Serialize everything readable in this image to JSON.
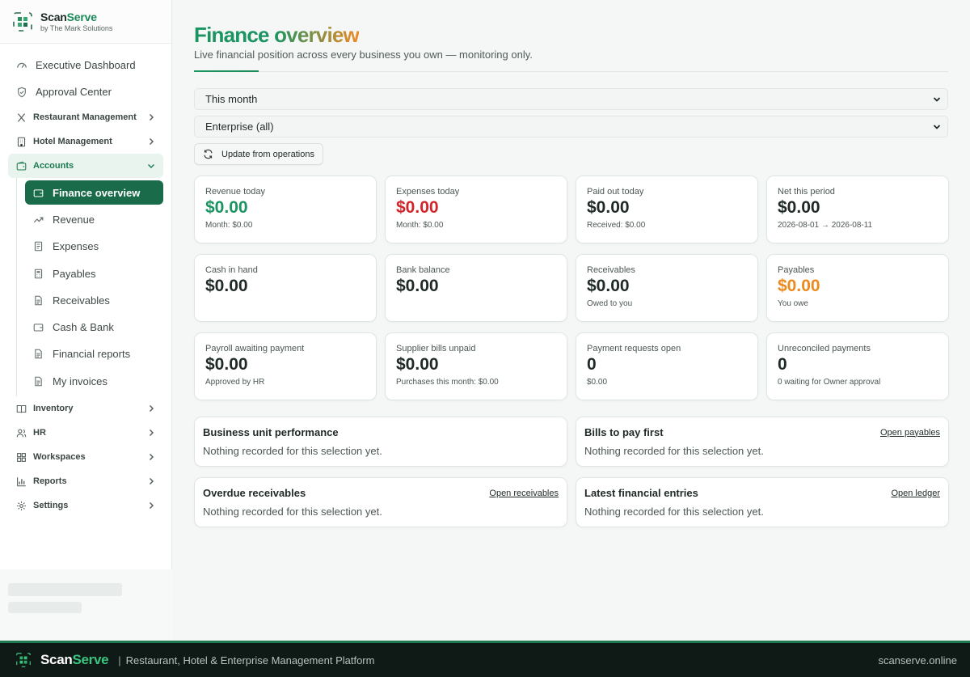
{
  "brand": {
    "name_a": "Scan",
    "name_b": "Serve",
    "sub": "by The Mark Solutions"
  },
  "sidebar": {
    "top_items": [
      {
        "label": "Executive Dashboard",
        "icon": "gauge-icon"
      },
      {
        "label": "Approval Center",
        "icon": "shield-check-icon"
      }
    ],
    "groups_before": [
      {
        "label": "Restaurant Management",
        "icon": "utensils-icon"
      },
      {
        "label": "Hotel Management",
        "icon": "building-icon"
      }
    ],
    "accounts": {
      "label": "Accounts",
      "icon": "wallet-icon",
      "items": [
        {
          "label": "Finance overview",
          "icon": "wallet-icon",
          "active": true
        },
        {
          "label": "Revenue",
          "icon": "trending-up-icon"
        },
        {
          "label": "Expenses",
          "icon": "receipt-icon"
        },
        {
          "label": "Payables",
          "icon": "calculator-icon"
        },
        {
          "label": "Receivables",
          "icon": "file-text-icon"
        },
        {
          "label": "Cash & Bank",
          "icon": "wallet-icon"
        },
        {
          "label": "Financial reports",
          "icon": "file-text-icon"
        },
        {
          "label": "My invoices",
          "icon": "file-text-icon"
        }
      ]
    },
    "groups_after": [
      {
        "label": "Inventory",
        "icon": "book-open-icon"
      },
      {
        "label": "HR",
        "icon": "users-icon"
      },
      {
        "label": "Workspaces",
        "icon": "grid-icon"
      },
      {
        "label": "Reports",
        "icon": "bar-chart-icon"
      },
      {
        "label": "Settings",
        "icon": "gear-icon"
      }
    ]
  },
  "page": {
    "title_a": "Finance ",
    "title_b": "overview",
    "subtitle": "Live financial position across every business you own — monitoring only."
  },
  "filters": {
    "period": "This month",
    "scope": "Enterprise (all)",
    "update_button": "Update from operations"
  },
  "cards": [
    {
      "label": "Revenue today",
      "value": "$0.00",
      "tone": "green",
      "note": "Month: $0.00"
    },
    {
      "label": "Expenses today",
      "value": "$0.00",
      "tone": "red",
      "note": "Month: $0.00"
    },
    {
      "label": "Paid out today",
      "value": "$0.00",
      "tone": "default",
      "note": "Received: $0.00"
    },
    {
      "label": "Net this period",
      "value": "$0.00",
      "tone": "default",
      "note": "2026-08-01 → 2026-08-11"
    },
    {
      "label": "Cash in hand",
      "value": "$0.00",
      "tone": "default",
      "note": ""
    },
    {
      "label": "Bank balance",
      "value": "$0.00",
      "tone": "default",
      "note": ""
    },
    {
      "label": "Receivables",
      "value": "$0.00",
      "tone": "default",
      "note": "Owed to you"
    },
    {
      "label": "Payables",
      "value": "$0.00",
      "tone": "orange",
      "note": "You owe"
    },
    {
      "label": "Payroll awaiting payment",
      "value": "$0.00",
      "tone": "default",
      "note": "Approved by HR"
    },
    {
      "label": "Supplier bills unpaid",
      "value": "$0.00",
      "tone": "default",
      "note": "Purchases this month: $0.00"
    },
    {
      "label": "Payment requests open",
      "value": "0",
      "tone": "default",
      "note": "$0.00"
    },
    {
      "label": "Unreconciled payments",
      "value": "0",
      "tone": "default",
      "note": "0 waiting for Owner approval"
    }
  ],
  "panels": [
    {
      "title": "Business unit performance",
      "link": "",
      "body": "Nothing recorded for this selection yet."
    },
    {
      "title": "Bills to pay first",
      "link": "Open payables",
      "body": "Nothing recorded for this selection yet."
    },
    {
      "title": "Overdue receivables",
      "link": "Open receivables",
      "body": "Nothing recorded for this selection yet."
    },
    {
      "title": "Latest financial entries",
      "link": "Open ledger",
      "body": "Nothing recorded for this selection yet."
    }
  ],
  "footer": {
    "name_a": "Scan",
    "name_b": "Serve",
    "separator": "|",
    "tagline": "Restaurant, Hotel & Enterprise Management Platform",
    "domain": "scanserve.online"
  },
  "colors": {
    "brand_green": "#1b9462",
    "active_bg": "#1a6b4a",
    "accent_orange": "#f08a24",
    "danger": "#d0252b"
  }
}
